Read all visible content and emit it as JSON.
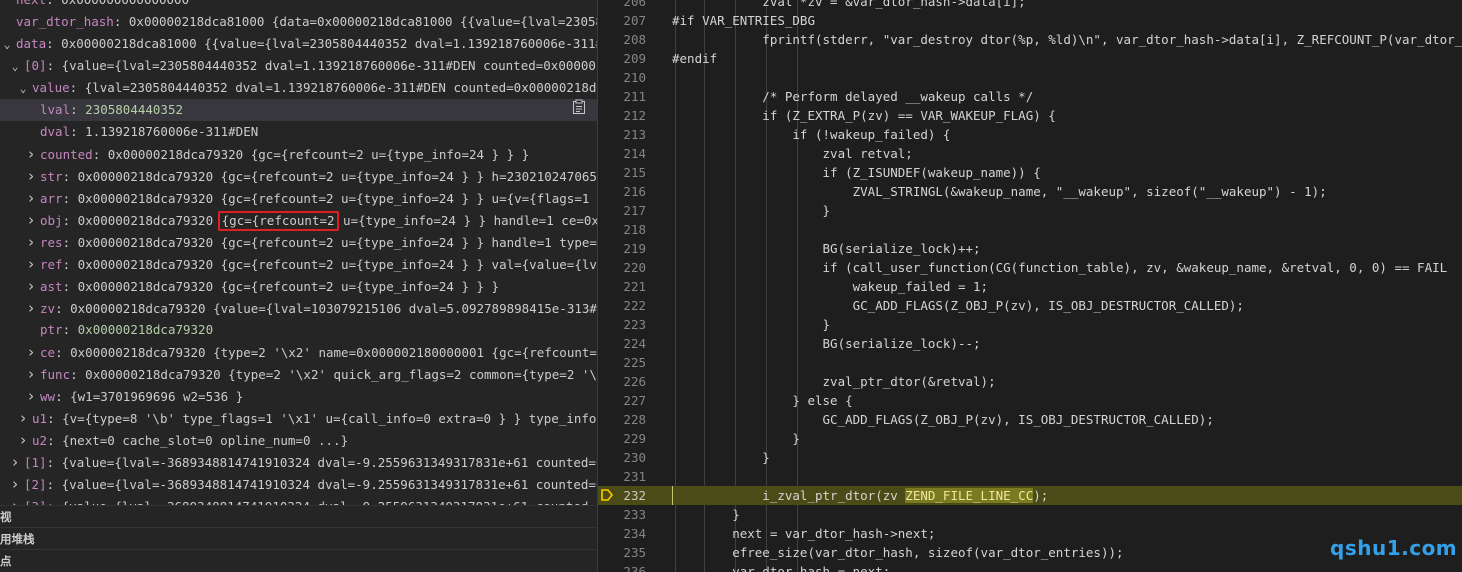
{
  "variables": [
    {
      "indent": 0,
      "twisty": "",
      "name": "next",
      "value": "0x000000000000000"
    },
    {
      "indent": 0,
      "twisty": "",
      "name": "var_dtor_hash",
      "value": "0x00000218dca81000 {data=0x00000218dca81000 {{value={lval=23058044..."
    },
    {
      "indent": 0,
      "twisty": "v",
      "name": "data",
      "value": "0x00000218dca81000 {{value={lval=2305804440352 dval=1.139218760006e-311#DE..."
    },
    {
      "indent": 1,
      "twisty": "v",
      "name": "[0]",
      "value": "{value={lval=2305804440352 dval=1.139218760006e-311#DEN counted=0x00000218..."
    },
    {
      "indent": 2,
      "twisty": "v",
      "name": "value",
      "value": "{lval=2305804440352 dval=1.139218760006e-311#DEN counted=0x00000218dca7..."
    },
    {
      "indent": 3,
      "twisty": "",
      "name": "lval",
      "value": "2305804440352",
      "numeric": true,
      "selected": true
    },
    {
      "indent": 3,
      "twisty": "",
      "name": "dval",
      "value": "1.139218760006e-311#DEN"
    },
    {
      "indent": 3,
      "twisty": ">",
      "name": "counted",
      "value": "0x00000218dca79320 {gc={refcount=2 u={type_info=24 } } }"
    },
    {
      "indent": 3,
      "twisty": ">",
      "name": "str",
      "value": "0x00000218dca79320 {gc={refcount=2 u={type_info=24 } } h=2302102470657 l..."
    },
    {
      "indent": 3,
      "twisty": ">",
      "name": "arr",
      "value": "0x00000218dca79320 {gc={refcount=2 u={type_info=24 } } u={v={flags=1 '\\x..."
    },
    {
      "indent": 3,
      "twisty": ">",
      "name": "obj",
      "value_pre": "0x00000218dca79320 ",
      "value_boxed": "{gc={refcount=2",
      "value_post": " u={type_info=24 } } handle=1 ce=0x000..."
    },
    {
      "indent": 3,
      "twisty": ">",
      "name": "res",
      "value": "0x00000218dca79320 {gc={refcount=2 u={type_info=24 } } handle=1 type=536..."
    },
    {
      "indent": 3,
      "twisty": ">",
      "name": "ref",
      "value": "0x00000218dca79320 {gc={refcount=2 u={type_info=24 } } val={value={lval=..."
    },
    {
      "indent": 3,
      "twisty": ">",
      "name": "ast",
      "value": "0x00000218dca79320 {gc={refcount=2 u={type_info=24 } } }"
    },
    {
      "indent": 3,
      "twisty": ">",
      "name": "zv",
      "value": "0x00000218dca79320 {value={lval=103079215106 dval=5.092789898415e-313#DEN..."
    },
    {
      "indent": 3,
      "twisty": "",
      "name": "ptr",
      "value": "0x00000218dca79320",
      "numeric": true
    },
    {
      "indent": 3,
      "twisty": ">",
      "name": "ce",
      "value": "0x00000218dca79320 {type=2 '\\x2' name=0x000002180000001 {gc={refcount=??..."
    },
    {
      "indent": 3,
      "twisty": ">",
      "name": "func",
      "value": "0x00000218dca79320 {type=2 '\\x2' quick_arg_flags=2 common={type=2 '\\x2'..."
    },
    {
      "indent": 3,
      "twisty": ">",
      "name": "ww",
      "value": "{w1=3701969696 w2=536 }"
    },
    {
      "indent": 2,
      "twisty": ">",
      "name": "u1",
      "value": "{v={type=8 '\\b' type_flags=1 '\\x1' u={call_info=0 extra=0 } } type_info=26..."
    },
    {
      "indent": 2,
      "twisty": ">",
      "name": "u2",
      "value": "{next=0 cache_slot=0 opline_num=0 ...}"
    },
    {
      "indent": 1,
      "twisty": ">",
      "name": "[1]",
      "value": "{value={lval=-3689348814741910324 dval=-9.2559631349317831e+61 counted=0xc..."
    },
    {
      "indent": 1,
      "twisty": ">",
      "name": "[2]",
      "value": "{value={lval=-3689348814741910324 dval=-9.2559631349317831e+61 counted=0xc..."
    },
    {
      "indent": 1,
      "twisty": ">",
      "name": "[3]",
      "value": "{value={lval=-3689348814741910324 dval=-9.2559631349317831e+61 counted=0xc..."
    }
  ],
  "sections": [
    "视",
    "用堆栈",
    "点"
  ],
  "editor": {
    "current_line": 232,
    "lines": [
      {
        "n": 206,
        "text": "            zval *zv = &var_dtor_hash->data[i];"
      },
      {
        "n": 207,
        "text": "#if VAR_ENTRIES_DBG"
      },
      {
        "n": 208,
        "text": "            fprintf(stderr, \"var_destroy dtor(%p, %ld)\\n\", var_dtor_hash->data[i], Z_REFCOUNT_P(var_dtor_"
      },
      {
        "n": 209,
        "text": "#endif"
      },
      {
        "n": 210,
        "text": ""
      },
      {
        "n": 211,
        "text": "            /* Perform delayed __wakeup calls */"
      },
      {
        "n": 212,
        "text": "            if (Z_EXTRA_P(zv) == VAR_WAKEUP_FLAG) {"
      },
      {
        "n": 213,
        "text": "                if (!wakeup_failed) {"
      },
      {
        "n": 214,
        "text": "                    zval retval;"
      },
      {
        "n": 215,
        "text": "                    if (Z_ISUNDEF(wakeup_name)) {"
      },
      {
        "n": 216,
        "text": "                        ZVAL_STRINGL(&wakeup_name, \"__wakeup\", sizeof(\"__wakeup\") - 1);"
      },
      {
        "n": 217,
        "text": "                    }"
      },
      {
        "n": 218,
        "text": ""
      },
      {
        "n": 219,
        "text": "                    BG(serialize_lock)++;"
      },
      {
        "n": 220,
        "text": "                    if (call_user_function(CG(function_table), zv, &wakeup_name, &retval, 0, 0) == FAIL"
      },
      {
        "n": 221,
        "text": "                        wakeup_failed = 1;"
      },
      {
        "n": 222,
        "text": "                        GC_ADD_FLAGS(Z_OBJ_P(zv), IS_OBJ_DESTRUCTOR_CALLED);"
      },
      {
        "n": 223,
        "text": "                    }"
      },
      {
        "n": 224,
        "text": "                    BG(serialize_lock)--;"
      },
      {
        "n": 225,
        "text": ""
      },
      {
        "n": 226,
        "text": "                    zval_ptr_dtor(&retval);"
      },
      {
        "n": 227,
        "text": "                } else {"
      },
      {
        "n": 228,
        "text": "                    GC_ADD_FLAGS(Z_OBJ_P(zv), IS_OBJ_DESTRUCTOR_CALLED);"
      },
      {
        "n": 229,
        "text": "                }"
      },
      {
        "n": 230,
        "text": "            }"
      },
      {
        "n": 231,
        "text": ""
      },
      {
        "n": 232,
        "text_pre": "            i_zval_ptr_dtor(zv ",
        "text_hl": "ZEND_FILE_LINE_CC",
        "text_post": ");"
      },
      {
        "n": 233,
        "text": "        }"
      },
      {
        "n": 234,
        "text": "        next = var_dtor_hash->next;"
      },
      {
        "n": 235,
        "text": "        efree_size(var_dtor_hash, sizeof(var_dtor_entries));"
      },
      {
        "n": 236,
        "text": "        var_dtor_hash = next;"
      }
    ]
  },
  "watermark": "qshu1.com",
  "colors": {
    "var_name": "#c586c0",
    "numeric": "#b5cea8",
    "current_line_bg": "#4b4b18",
    "highlight_box": "#e02020",
    "watermark": "#33a0e8"
  }
}
